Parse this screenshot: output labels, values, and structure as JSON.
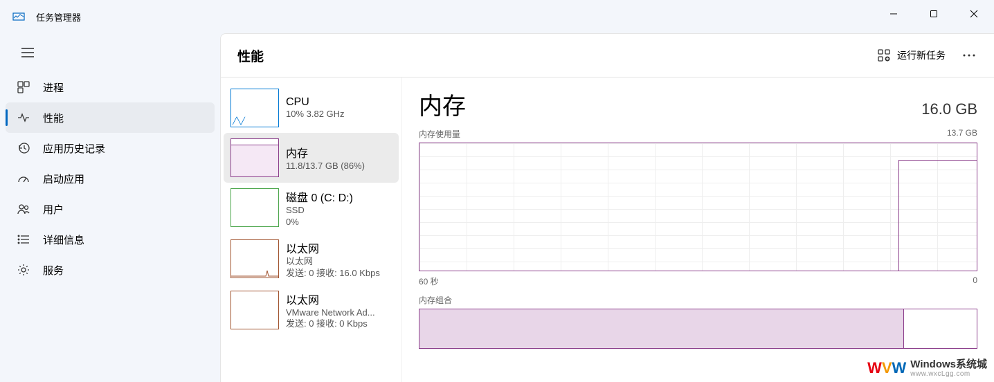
{
  "window": {
    "title": "任务管理器"
  },
  "sidebar": {
    "items": [
      {
        "label": "进程"
      },
      {
        "label": "性能"
      },
      {
        "label": "应用历史记录"
      },
      {
        "label": "启动应用"
      },
      {
        "label": "用户"
      },
      {
        "label": "详细信息"
      },
      {
        "label": "服务"
      }
    ]
  },
  "content": {
    "title": "性能",
    "run_task_label": "运行新任务"
  },
  "perf_list": [
    {
      "name": "CPU",
      "sub": "10%  3.82 GHz"
    },
    {
      "name": "内存",
      "sub": "11.8/13.7 GB (86%)"
    },
    {
      "name": "磁盘 0 (C: D:)",
      "sub1": "SSD",
      "sub2": "0%"
    },
    {
      "name": "以太网",
      "sub1": "以太网",
      "sub2": "发送: 0 接收: 16.0 Kbps"
    },
    {
      "name": "以太网",
      "sub1": "VMware Network Ad...",
      "sub2": "发送: 0 接收: 0 Kbps"
    }
  ],
  "detail": {
    "title": "内存",
    "total": "16.0 GB",
    "usage_label": "内存使用量",
    "usage_max": "13.7 GB",
    "x_start": "60 秒",
    "x_end": "0",
    "composition_label": "内存组合"
  },
  "watermark": {
    "main": "Windows系统城",
    "sub": "www.wxcLgg.com"
  }
}
